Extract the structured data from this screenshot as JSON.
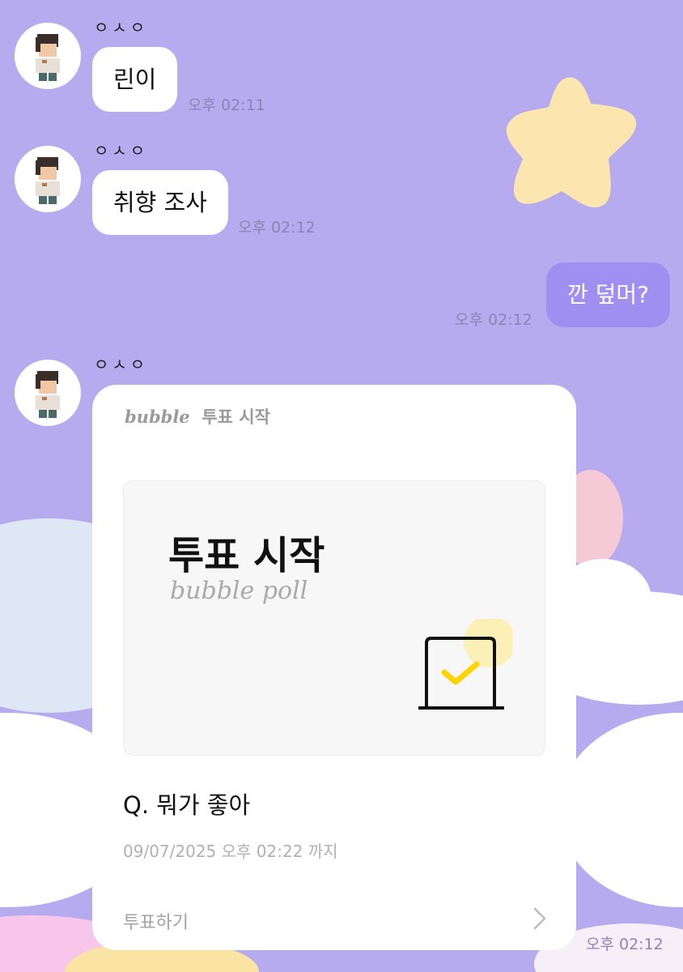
{
  "messages": [
    {
      "sender": "ㅇㅅㅇ",
      "text": "린이",
      "time": "오후 02:11"
    },
    {
      "sender": "ㅇㅅㅇ",
      "text": "취향 조사",
      "time": "오후 02:12"
    },
    {
      "text": "깐 덮머?",
      "time": "오후 02:12"
    }
  ],
  "poll": {
    "sender": "ㅇㅅㅇ",
    "brand": "bubble",
    "header_title": "투표 시작",
    "banner_title": "투표 시작",
    "banner_subtitle": "bubble poll",
    "question": "Q. 뭐가 좋아",
    "deadline": "09/07/2025 오후 02:22 까지",
    "action_label": "투표하기",
    "time": "오후 02:12",
    "icon": "ballot-box-check-icon"
  },
  "colors": {
    "background": "#b5abee",
    "outgoing_bubble": "#9f8ff0",
    "star": "#fbe6b0",
    "check": "#ffd400"
  }
}
